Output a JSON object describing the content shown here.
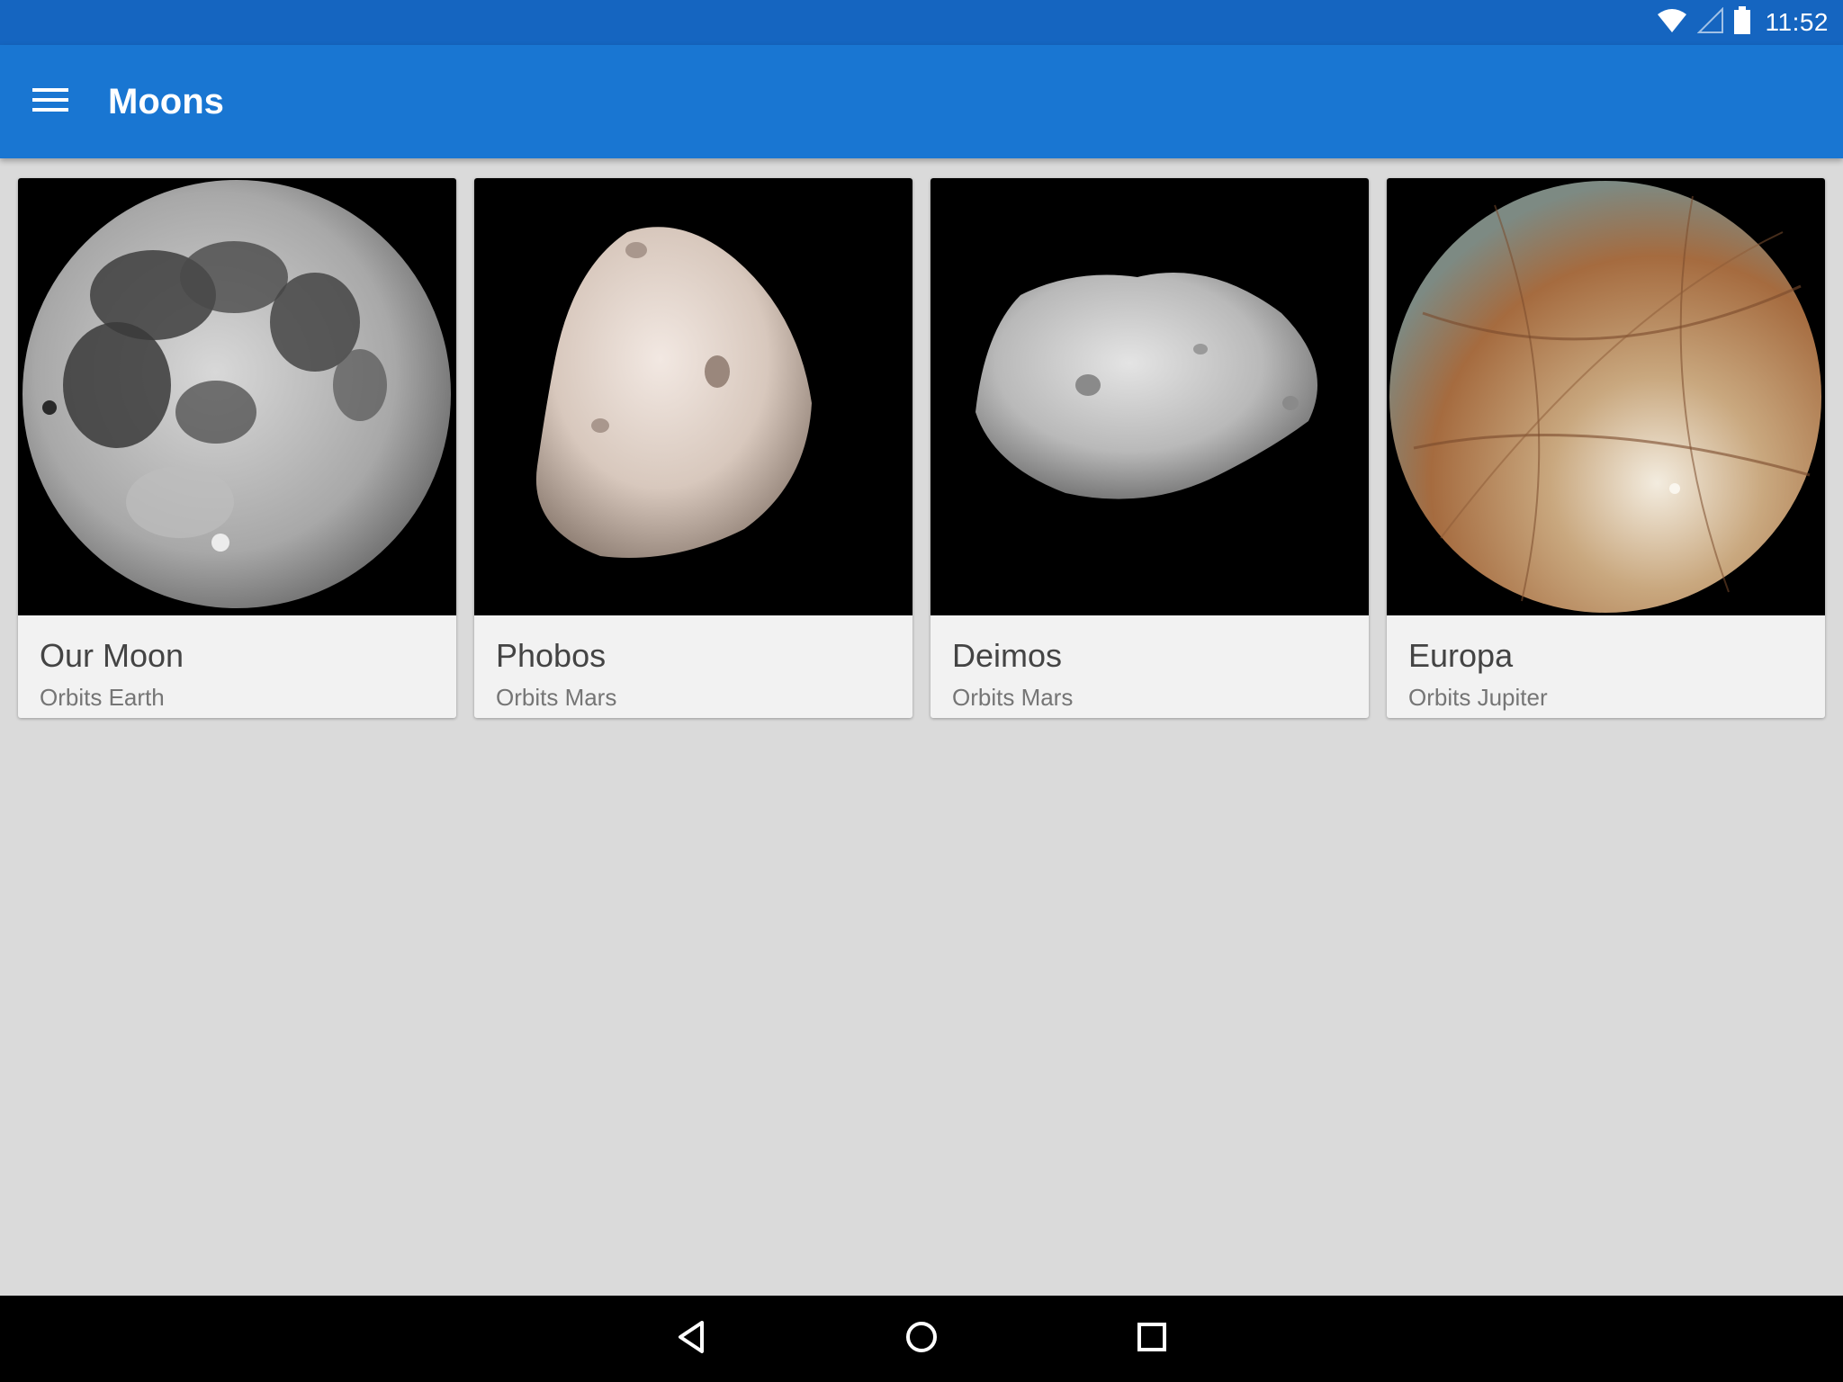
{
  "status_bar": {
    "time": "11:52",
    "icons": [
      "wifi-icon",
      "cell-signal-icon",
      "battery-icon"
    ]
  },
  "app_bar": {
    "title": "Moons",
    "menu_icon": "hamburger-menu-icon",
    "color": "#1976d2"
  },
  "colors": {
    "status_bar": "#1565c0",
    "background": "#dadada",
    "card": "#f2f2f2"
  },
  "cards": [
    {
      "title": "Our Moon",
      "subtitle": "Orbits Earth",
      "image": "full-moon-image"
    },
    {
      "title": "Phobos",
      "subtitle": "Orbits Mars",
      "image": "phobos-image"
    },
    {
      "title": "Deimos",
      "subtitle": "Orbits Mars",
      "image": "deimos-image"
    },
    {
      "title": "Europa",
      "subtitle": "Orbits Jupiter",
      "image": "europa-image"
    }
  ],
  "nav_bar": {
    "icons": [
      "back-icon",
      "home-icon",
      "recents-icon"
    ]
  }
}
